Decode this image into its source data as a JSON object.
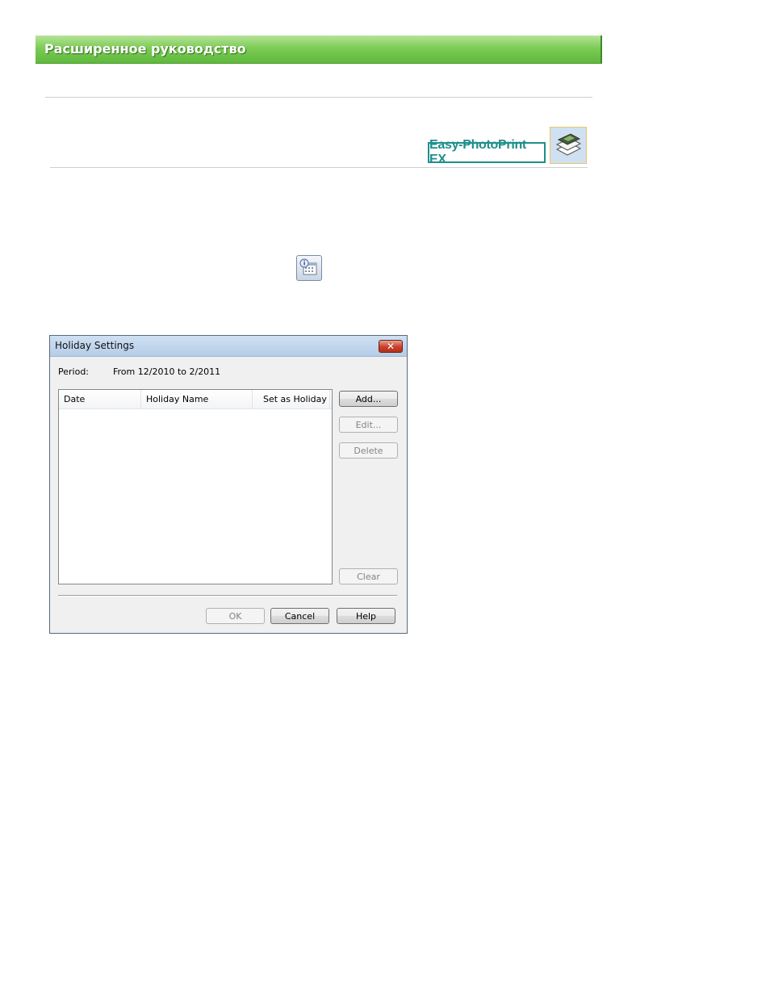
{
  "header": {
    "title": "Расширенное руководство"
  },
  "brand": {
    "product_name": "Easy-PhotoPrint EX"
  },
  "dialog": {
    "title": "Holiday Settings",
    "close_glyph": "✕",
    "period_label": "Period:",
    "period_value": "From 12/2010 to 2/2011",
    "columns": [
      "Date",
      "Holiday Name",
      "Set as Holiday"
    ],
    "buttons": {
      "add": "Add...",
      "edit": "Edit...",
      "delete": "Delete",
      "clear": "Clear",
      "ok": "OK",
      "cancel": "Cancel",
      "help": "Help"
    }
  },
  "colors": {
    "header_green": "#6cc24a",
    "brand_teal": "#1f8f8a"
  }
}
